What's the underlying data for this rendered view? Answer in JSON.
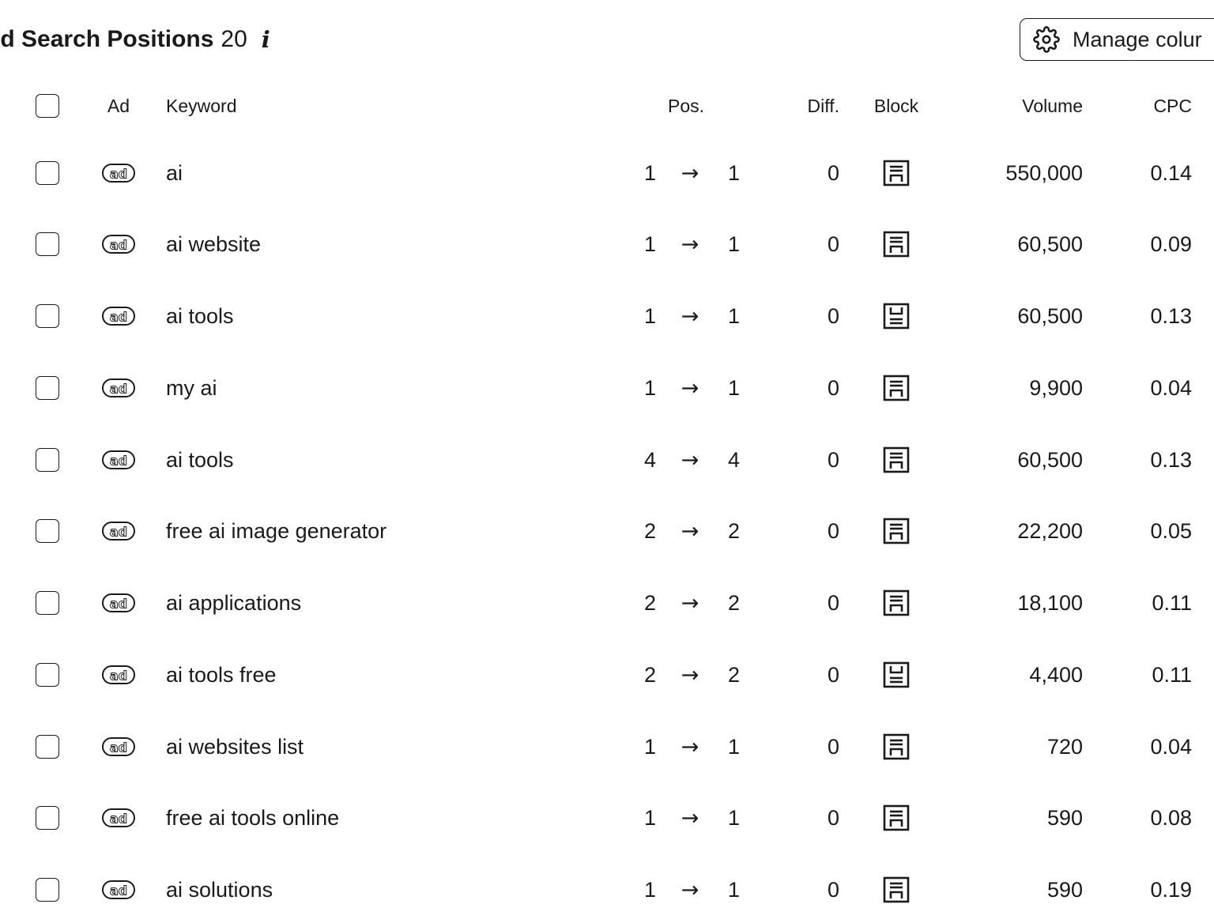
{
  "header": {
    "title": "id Search Positions",
    "count": "20",
    "info_glyph": "i",
    "manage_columns_label": "Manage colur"
  },
  "table": {
    "columns": {
      "ad": "Ad",
      "keyword": "Keyword",
      "pos": "Pos.",
      "diff": "Diff.",
      "block": "Block",
      "volume": "Volume",
      "cpc": "CPC"
    },
    "arrow_glyph": "→",
    "rows": [
      {
        "keyword": "ai",
        "pos_from": "1",
        "pos_to": "1",
        "diff": "0",
        "block_icon": "serp-block-icon",
        "volume": "550,000",
        "cpc": "0.14"
      },
      {
        "keyword": "ai website",
        "pos_from": "1",
        "pos_to": "1",
        "diff": "0",
        "block_icon": "serp-block-icon",
        "volume": "60,500",
        "cpc": "0.09"
      },
      {
        "keyword": "ai tools",
        "pos_from": "1",
        "pos_to": "1",
        "diff": "0",
        "block_icon": "serp-block-bottom-icon",
        "volume": "60,500",
        "cpc": "0.13"
      },
      {
        "keyword": "my ai",
        "pos_from": "1",
        "pos_to": "1",
        "diff": "0",
        "block_icon": "serp-block-icon",
        "volume": "9,900",
        "cpc": "0.04"
      },
      {
        "keyword": "ai tools",
        "pos_from": "4",
        "pos_to": "4",
        "diff": "0",
        "block_icon": "serp-block-icon",
        "volume": "60,500",
        "cpc": "0.13"
      },
      {
        "keyword": "free ai image generator",
        "pos_from": "2",
        "pos_to": "2",
        "diff": "0",
        "block_icon": "serp-block-icon",
        "volume": "22,200",
        "cpc": "0.05"
      },
      {
        "keyword": "ai applications",
        "pos_from": "2",
        "pos_to": "2",
        "diff": "0",
        "block_icon": "serp-block-icon",
        "volume": "18,100",
        "cpc": "0.11"
      },
      {
        "keyword": "ai tools free",
        "pos_from": "2",
        "pos_to": "2",
        "diff": "0",
        "block_icon": "serp-block-bottom-icon",
        "volume": "4,400",
        "cpc": "0.11"
      },
      {
        "keyword": "ai websites list",
        "pos_from": "1",
        "pos_to": "1",
        "diff": "0",
        "block_icon": "serp-block-icon",
        "volume": "720",
        "cpc": "0.04"
      },
      {
        "keyword": "free ai tools online",
        "pos_from": "1",
        "pos_to": "1",
        "diff": "0",
        "block_icon": "serp-block-icon",
        "volume": "590",
        "cpc": "0.08"
      },
      {
        "keyword": "ai solutions",
        "pos_from": "1",
        "pos_to": "1",
        "diff": "0",
        "block_icon": "serp-block-icon",
        "volume": "590",
        "cpc": "0.19"
      }
    ]
  }
}
